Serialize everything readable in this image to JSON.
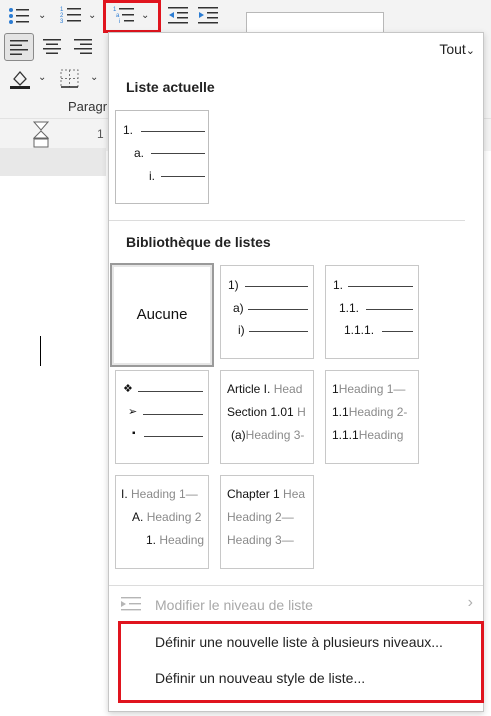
{
  "ribbon": {
    "group_label": "Paragr",
    "ruler_number": "1",
    "colors": {
      "highlight": "#e0141e",
      "icon_blue": "#2b7cd3"
    }
  },
  "panel": {
    "filter_label": "Tout",
    "current_section_title": "Liste actuelle",
    "library_section_title": "Bibliothèque de listes",
    "current_list": {
      "levels": [
        "1.",
        "a.",
        "i."
      ]
    },
    "library": {
      "none_label": "Aucune",
      "tile2": [
        "1)",
        "a)",
        "i)"
      ],
      "tile3": [
        "1.",
        "1.1.",
        "1.1.1."
      ],
      "tile4": [
        "❖",
        "➢",
        "▪"
      ],
      "tile5": {
        "l1_prefix": "Article I.",
        "l1_gray": "Head",
        "l2_prefix": "Section 1.01",
        "l2_gray": "H",
        "l3_prefix": "(a)",
        "l3_gray": "Heading 3-"
      },
      "tile6": {
        "l1_prefix": "1",
        "l1_gray": "Heading 1—",
        "l2_prefix": "1.1",
        "l2_gray": "Heading 2-",
        "l3_prefix": "1.1.1",
        "l3_gray": "Heading"
      },
      "tile7": {
        "l1_prefix": "I.",
        "l1_gray": "Heading 1—",
        "l2_prefix": "A.",
        "l2_gray": "Heading 2",
        "l3_prefix": "1.",
        "l3_gray": "Heading"
      },
      "tile8": {
        "l1_prefix": "Chapter 1",
        "l1_gray": "Hea",
        "l2_gray": "Heading 2—",
        "l3_gray": "Heading 3—"
      }
    },
    "menu": {
      "change_level": "Modifier le niveau de liste",
      "define_multilevel": "Définir une nouvelle liste à plusieurs niveaux...",
      "define_style": "Définir un nouveau style de liste..."
    }
  }
}
